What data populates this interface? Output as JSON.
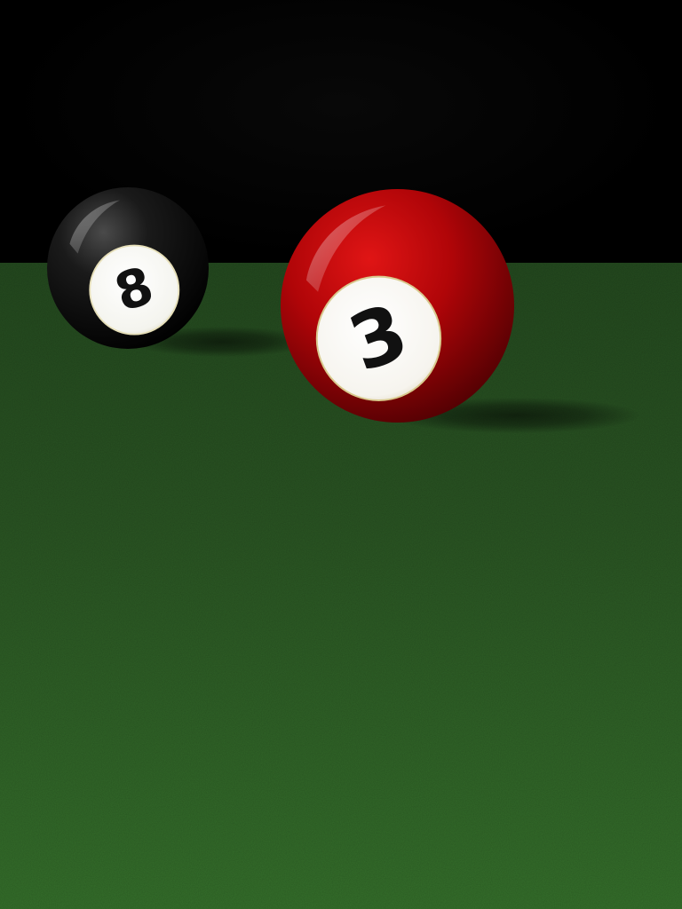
{
  "scene": {
    "balls": [
      {
        "number": "8",
        "color": "#111111",
        "highlight": "#5a5a5a"
      },
      {
        "number": "3",
        "color": "#c8080d",
        "highlight": "#ff5a5a"
      }
    ],
    "felt_color": "#2a5523",
    "backdrop_color": "#000000",
    "number_ink_color": "#111111",
    "number_disc_color": "#f7f7f2"
  }
}
